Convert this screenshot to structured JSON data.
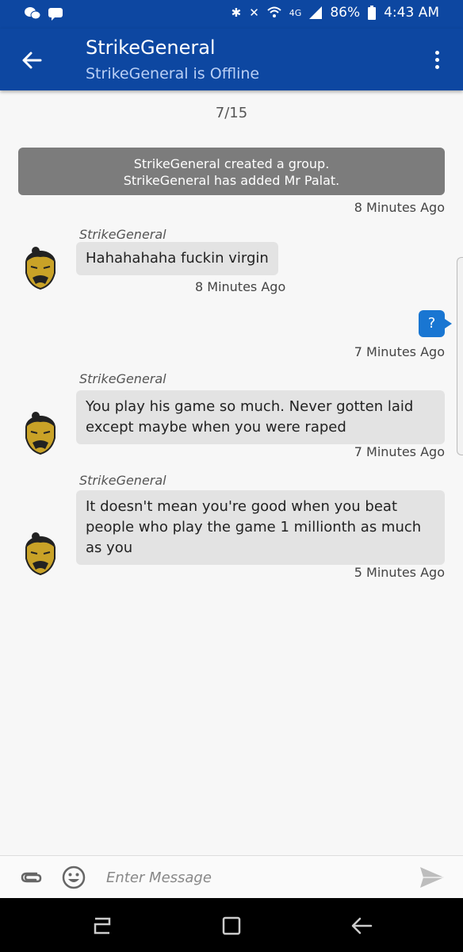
{
  "status_bar": {
    "battery": "86%",
    "time": "4:43 AM",
    "network": "4G"
  },
  "header": {
    "title": "StrikeGeneral",
    "subtitle": "StrikeGeneral is Offline"
  },
  "chat": {
    "date": "7/15",
    "system_message": {
      "line1": "StrikeGeneral created a group.",
      "line2": "StrikeGeneral has added Mr Palat.",
      "time": "8 Minutes Ago"
    },
    "messages": [
      {
        "sender": "StrikeGeneral",
        "text": "Hahahahaha fuckin virgin",
        "time": "8 Minutes Ago"
      },
      {
        "sender": "me",
        "text": "?",
        "time": "7 Minutes Ago"
      },
      {
        "sender": "StrikeGeneral",
        "line1": "You play his game so much. Never gotten laid",
        "line2": "except maybe when you were raped",
        "time": "7 Minutes Ago"
      },
      {
        "sender": "StrikeGeneral",
        "line1": "It doesn't mean you're good when you beat",
        "line2": "people who play the game 1 millionth as much",
        "line3": "as you",
        "time": "5 Minutes Ago"
      }
    ]
  },
  "input": {
    "placeholder": "Enter Message"
  },
  "icons": {
    "back": "back-arrow-icon",
    "menu": "more-vert-icon",
    "attach": "paperclip-icon",
    "emoji": "emoji-icon",
    "send": "send-icon",
    "avatar": "samurai-avatar"
  },
  "colors": {
    "app_bar": "#0d47a1",
    "outgoing_bubble": "#1976d2",
    "incoming_bubble": "#e3e3e3",
    "system_bubble": "#7c7c7c"
  }
}
